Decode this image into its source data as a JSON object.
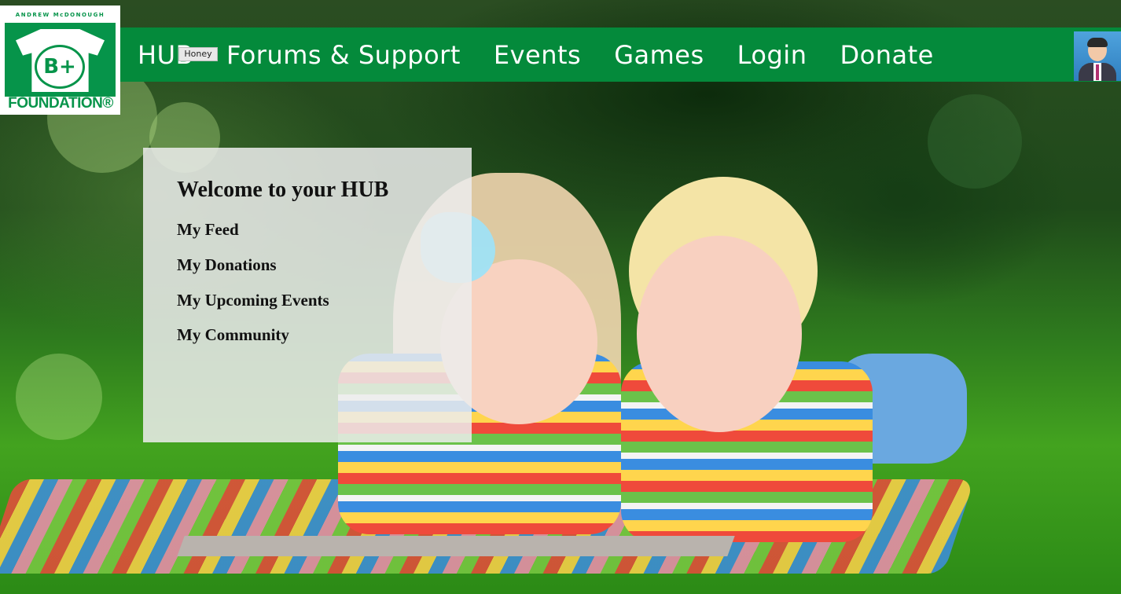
{
  "logo": {
    "tagline": "ANDREW McDONOUGH",
    "mark": "B+",
    "name": "FOUNDATION®"
  },
  "nav": {
    "items": [
      "HUB",
      "Forums & Support",
      "Events",
      "Games",
      "Login",
      "Donate"
    ],
    "tooltip": "Honey"
  },
  "colors": {
    "nav_green": "#048a3b",
    "logo_green": "#06944a",
    "panel_bg": "rgba(236,236,236,0.86)"
  },
  "icons": {
    "avatar": "user-avatar-icon"
  },
  "panel": {
    "title": "Welcome to your HUB",
    "links": [
      "My Feed",
      "My Donations",
      "My Upcoming Events",
      "My Community"
    ]
  }
}
